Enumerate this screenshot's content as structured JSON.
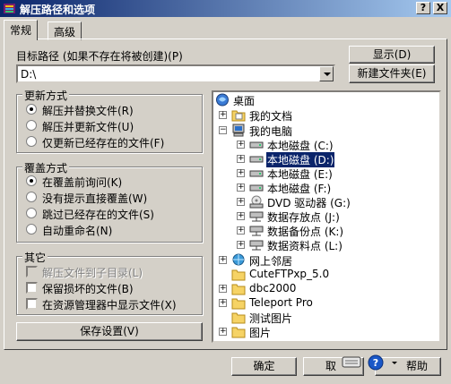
{
  "window": {
    "title": "解压路径和选项",
    "help_button": "?",
    "close_button": "X"
  },
  "tabs": [
    {
      "label": "常规"
    },
    {
      "label": "高级"
    }
  ],
  "target": {
    "label": "目标路径 (如果不存在将被创建)(P)",
    "value": "D:\\",
    "show_button": "显示(D)",
    "new_folder_button": "新建文件夹(E)"
  },
  "update_mode": {
    "title": "更新方式",
    "options": [
      {
        "label": "解压并替换文件(R)",
        "selected": true
      },
      {
        "label": "解压并更新文件(U)",
        "selected": false
      },
      {
        "label": "仅更新已经存在的文件(F)",
        "selected": false
      }
    ]
  },
  "overwrite_mode": {
    "title": "覆盖方式",
    "options": [
      {
        "label": "在覆盖前询问(K)",
        "selected": true
      },
      {
        "label": "没有提示直接覆盖(W)",
        "selected": false
      },
      {
        "label": "跳过已经存在的文件(S)",
        "selected": false
      },
      {
        "label": "自动重命名(N)",
        "selected": false
      }
    ]
  },
  "misc": {
    "title": "其它",
    "options": [
      {
        "label": "解压文件到子目录(L)",
        "checked": false,
        "disabled": true
      },
      {
        "label": "保留损坏的文件(B)",
        "checked": false,
        "disabled": false
      },
      {
        "label": "在资源管理器中显示文件(X)",
        "checked": false,
        "disabled": false
      }
    ]
  },
  "save_button": "保存设置(V)",
  "tree": {
    "nodes": [
      {
        "label": "桌面",
        "icon": "desktop-icon"
      },
      {
        "label": "我的文档",
        "icon": "folder-icon"
      },
      {
        "label": "我的电脑",
        "icon": "computer-icon"
      },
      {
        "label": "本地磁盘 (C:)",
        "icon": "drive-icon"
      },
      {
        "label": "本地磁盘 (D:)",
        "icon": "drive-icon",
        "selected": true
      },
      {
        "label": "本地磁盘 (E:)",
        "icon": "drive-icon"
      },
      {
        "label": "本地磁盘 (F:)",
        "icon": "drive-icon"
      },
      {
        "label": "DVD 驱动器 (G:)",
        "icon": "dvd-icon"
      },
      {
        "label": "数据存放点 (J:)",
        "icon": "network-drive-icon"
      },
      {
        "label": "数据备份点 (K:)",
        "icon": "network-drive-icon"
      },
      {
        "label": "数据资料点 (L:)",
        "icon": "network-drive-icon"
      },
      {
        "label": "网上邻居",
        "icon": "network-icon"
      },
      {
        "label": "CuteFTPxp_5.0",
        "icon": "folder-icon"
      },
      {
        "label": "dbc2000",
        "icon": "folder-icon"
      },
      {
        "label": "Teleport Pro",
        "icon": "folder-icon"
      },
      {
        "label": "测试图片",
        "icon": "folder-icon"
      },
      {
        "label": "图片",
        "icon": "folder-icon"
      }
    ]
  },
  "footer": {
    "ok": "确定",
    "cancel": "取",
    "help": "帮助"
  }
}
